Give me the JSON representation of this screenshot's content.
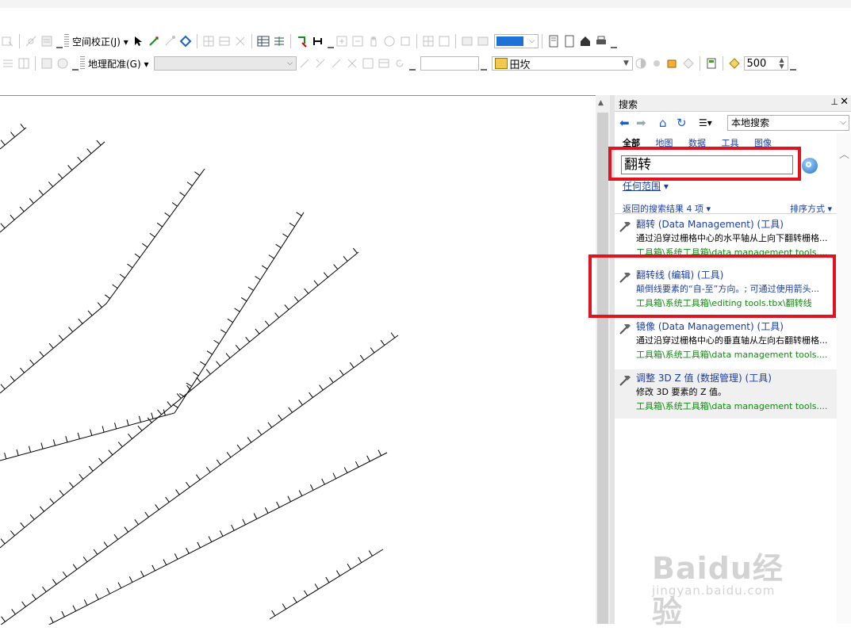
{
  "toolbar": {
    "spatial_adjust_label": "空间校正(J)",
    "georef_label": "地理配准(G)",
    "layer_combo_value": "田坎",
    "scale_value": "500"
  },
  "search_panel": {
    "title": "搜索",
    "scope_value": "本地搜索",
    "tabs": [
      "全部",
      "地图",
      "数据",
      "工具",
      "图像"
    ],
    "query": "翻转",
    "any_scope_label": "任何范围",
    "result_count": "返回的搜索结果 4 项",
    "sort_label": "排序方式",
    "results": [
      {
        "title": "翻转 (Data Management) (工具)",
        "desc": "通过沿穿过栅格中心的水平轴从上向下翻转栅格...",
        "path": "工具箱\\系统工具箱\\data management tools...."
      },
      {
        "title": "翻转线 (编辑) (工具)",
        "desc": "颠倒线要素的“自-至”方向。; 可通过使用箭头...",
        "path": "工具箱\\系统工具箱\\editing tools.tbx\\翻转线"
      },
      {
        "title": "镜像 (Data Management) (工具)",
        "desc": "通过沿穿过栅格中心的垂直轴从左向右翻转栅格...",
        "path": "工具箱\\系统工具箱\\data management tools...."
      },
      {
        "title": "调整 3D Z 值 (数据管理) (工具)",
        "desc": "修改 3D 要素的 Z 值。",
        "path": "工具箱\\系统工具箱\\data management tools...."
      }
    ]
  },
  "watermark": {
    "text": "Baidu经验",
    "url": "jingyan.baidu.com"
  },
  "colors": {
    "highlight": "#e0131e",
    "link": "#1a3da8",
    "path": "#128a12"
  }
}
